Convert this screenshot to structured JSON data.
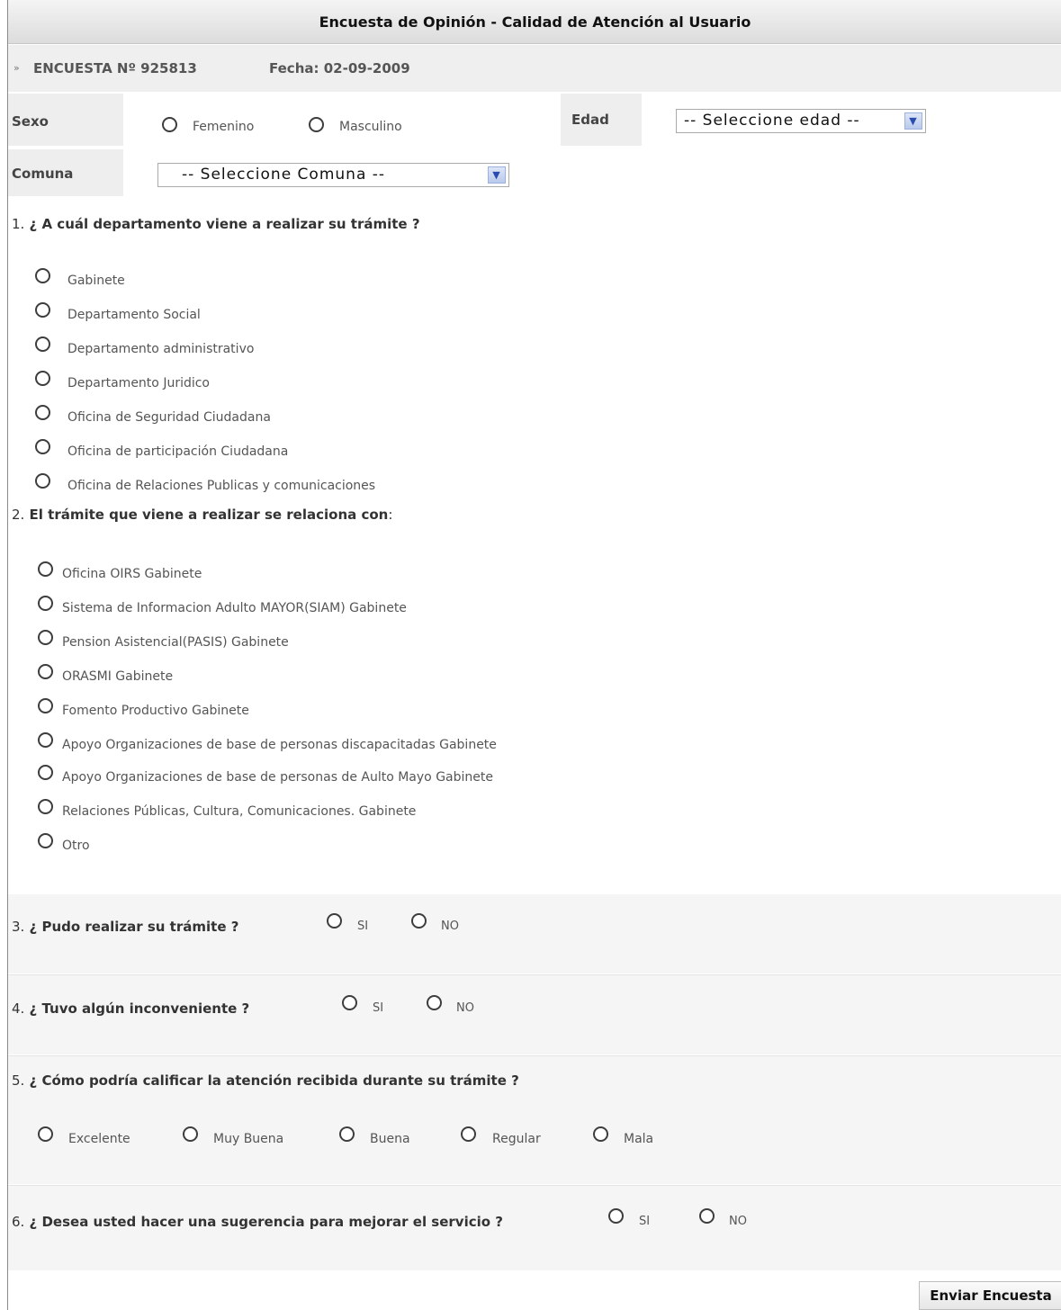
{
  "header": {
    "title": "Encuesta de Opinión - Calidad de Atención al Usuario"
  },
  "subheader": {
    "raquo": "»",
    "survey_no": "ENCUESTA Nº 925813",
    "date": "Fecha: 02-09-2009"
  },
  "sexo": {
    "label": "Sexo",
    "options": [
      "Femenino",
      "Masculino"
    ]
  },
  "edad": {
    "label": "Edad",
    "select_value": "-- Seleccione edad --"
  },
  "comuna": {
    "label": "Comuna",
    "select_value": "-- Seleccione Comuna --"
  },
  "q1": {
    "num": "1.",
    "text": "¿ A cuál departamento viene a realizar su trámite ?",
    "options": [
      "Gabinete",
      "Departamento Social",
      "Departamento administrativo",
      "Departamento Juridico",
      "Oficina de Seguridad Ciudadana",
      "Oficina de participación Ciudadana",
      "Oficina de Relaciones Publicas y comunicaciones"
    ]
  },
  "q2": {
    "num": "2.",
    "text": "El trámite que viene a realizar se relaciona con",
    "colon": ":",
    "options": [
      "Oficina OIRS Gabinete",
      "Sistema de Informacion Adulto MAYOR(SIAM) Gabinete",
      "Pension Asistencial(PASIS) Gabinete",
      "ORASMI Gabinete",
      "Fomento Productivo Gabinete",
      "Apoyo Organizaciones de base de personas discapacitadas Gabinete",
      "Apoyo Organizaciones de base de personas de Aulto Mayo Gabinete",
      "Relaciones Públicas, Cultura, Comunicaciones. Gabinete",
      "Otro"
    ]
  },
  "q3": {
    "num": "3.",
    "text": "¿ Pudo realizar su trámite ?",
    "options": [
      "SI",
      "NO"
    ]
  },
  "q4": {
    "num": "4.",
    "text": "¿ Tuvo algún inconveniente ?",
    "options": [
      "SI",
      "NO"
    ]
  },
  "q5": {
    "num": "5.",
    "text": "¿ Cómo podría calificar la atención recibida durante su trámite ?",
    "options": [
      "Excelente",
      "Muy Buena",
      "Buena",
      "Regular",
      "Mala"
    ]
  },
  "q6": {
    "num": "6.",
    "text": "¿ Desea usted hacer una sugerencia para mejorar el servicio ?",
    "options": [
      "SI",
      "NO"
    ]
  },
  "submit": {
    "label": "Enviar Encuesta"
  },
  "icons": {
    "select_arrow": "chevron-down-icon"
  }
}
